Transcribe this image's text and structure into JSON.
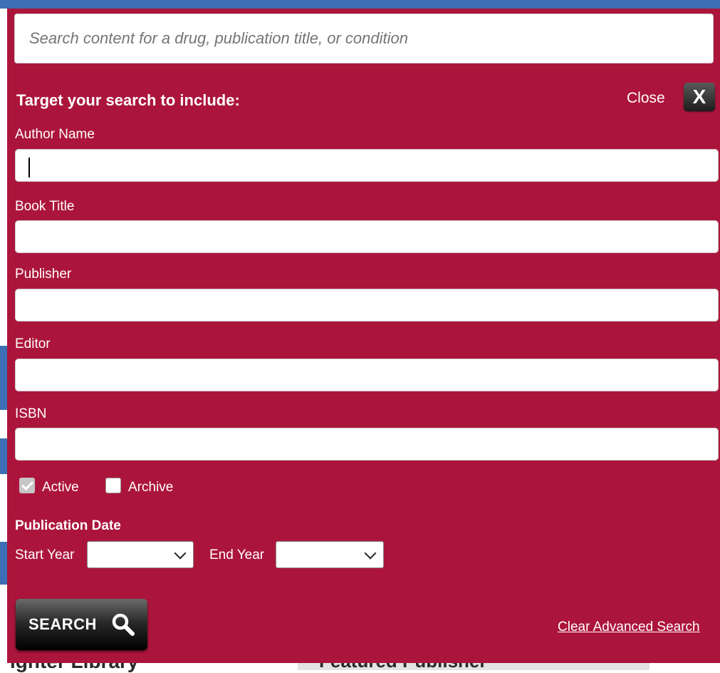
{
  "search": {
    "placeholder": "Search content for a drug, publication title, or condition"
  },
  "advanced": {
    "heading": "Target your search to include:",
    "close_label": "Close",
    "close_icon_glyph": "X",
    "fields": [
      {
        "label": "Author Name",
        "value": ""
      },
      {
        "label": "Book Title",
        "value": ""
      },
      {
        "label": "Publisher",
        "value": ""
      },
      {
        "label": "Editor",
        "value": ""
      },
      {
        "label": "ISBN",
        "value": ""
      }
    ],
    "filters": {
      "active": {
        "label": "Active",
        "checked": true
      },
      "archive": {
        "label": "Archive",
        "checked": false
      }
    },
    "publication_date": {
      "heading": "Publication Date",
      "start_label": "Start Year",
      "start_value": "",
      "end_label": "End Year",
      "end_value": ""
    },
    "search_button_label": "SEARCH",
    "search_icon": "magnifier-icon",
    "clear_link": "Clear Advanced Search"
  },
  "background_page": {
    "left_heading_fragment": "ighter Library",
    "right_heading_fragment": "Featured Publisher"
  },
  "colors": {
    "modal_bg": "#ac153b",
    "text_on_modal": "#ffffff",
    "page_accent": "#3d6fb4"
  }
}
